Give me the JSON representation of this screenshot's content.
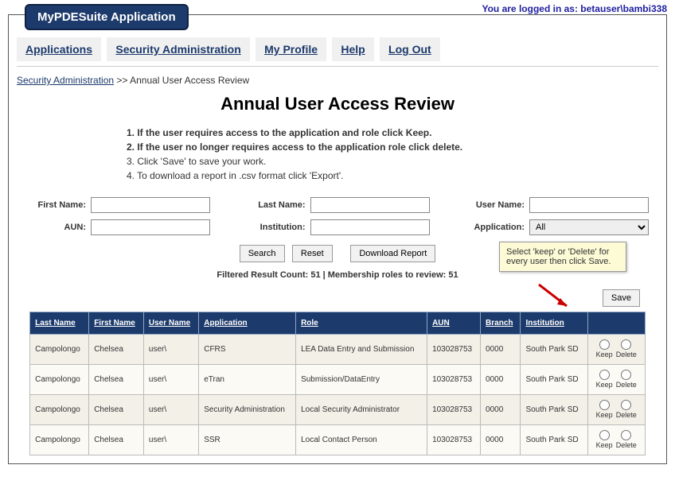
{
  "header": {
    "login_prefix": "You are logged in as: ",
    "login_user": "betauser\\bambi338",
    "app_title": "MyPDESuite Application"
  },
  "nav": {
    "applications": "Applications",
    "security_admin": "Security Administration",
    "my_profile": "My Profile",
    "help": "Help",
    "log_out": "Log Out"
  },
  "breadcrumb": {
    "link": "Security Administration",
    "sep": " >> ",
    "current": "Annual User Access Review"
  },
  "page_title": "Annual User Access Review",
  "instructions": {
    "line1": "1. If the user requires access to the application and role click Keep.",
    "line2": "2. If the user no longer requires access to the application role click delete.",
    "line3": "3. Click 'Save' to save your work.",
    "line4": "4. To download a report in .csv format click 'Export'."
  },
  "search": {
    "first_name_label": "First Name:",
    "aun_label": "AUN:",
    "last_name_label": "Last Name:",
    "institution_label": "Institution:",
    "user_name_label": "User Name:",
    "application_label": "Application:",
    "application_value": "All"
  },
  "buttons": {
    "search": "Search",
    "reset": "Reset",
    "download": "Download Report",
    "save": "Save"
  },
  "tooltip": "Select 'keep' or 'Delete' for every user then click Save.",
  "result_count": "Filtered Result Count: 51 | Membership roles to review: 51",
  "table": {
    "headers": {
      "last_name": "Last Name",
      "first_name": "First Name",
      "user_name": "User Name",
      "application": "Application",
      "role": "Role",
      "aun": "AUN",
      "branch": "Branch",
      "institution": "Institution"
    },
    "radio_labels": {
      "keep": "Keep",
      "delete": "Delete"
    },
    "rows": [
      {
        "last_name": "Campolongo",
        "first_name": "Chelsea",
        "user_name": "user\\",
        "application": "CFRS",
        "role": "LEA Data Entry and Submission",
        "aun": "103028753",
        "branch": "0000",
        "institution": "South Park SD"
      },
      {
        "last_name": "Campolongo",
        "first_name": "Chelsea",
        "user_name": "user\\",
        "application": "eTran",
        "role": "Submission/DataEntry",
        "aun": "103028753",
        "branch": "0000",
        "institution": "South Park SD"
      },
      {
        "last_name": "Campolongo",
        "first_name": "Chelsea",
        "user_name": "user\\",
        "application": "Security Administration",
        "role": "Local Security Administrator",
        "aun": "103028753",
        "branch": "0000",
        "institution": "South Park SD"
      },
      {
        "last_name": "Campolongo",
        "first_name": "Chelsea",
        "user_name": "user\\",
        "application": "SSR",
        "role": "Local Contact Person",
        "aun": "103028753",
        "branch": "0000",
        "institution": "South Park SD"
      }
    ]
  }
}
